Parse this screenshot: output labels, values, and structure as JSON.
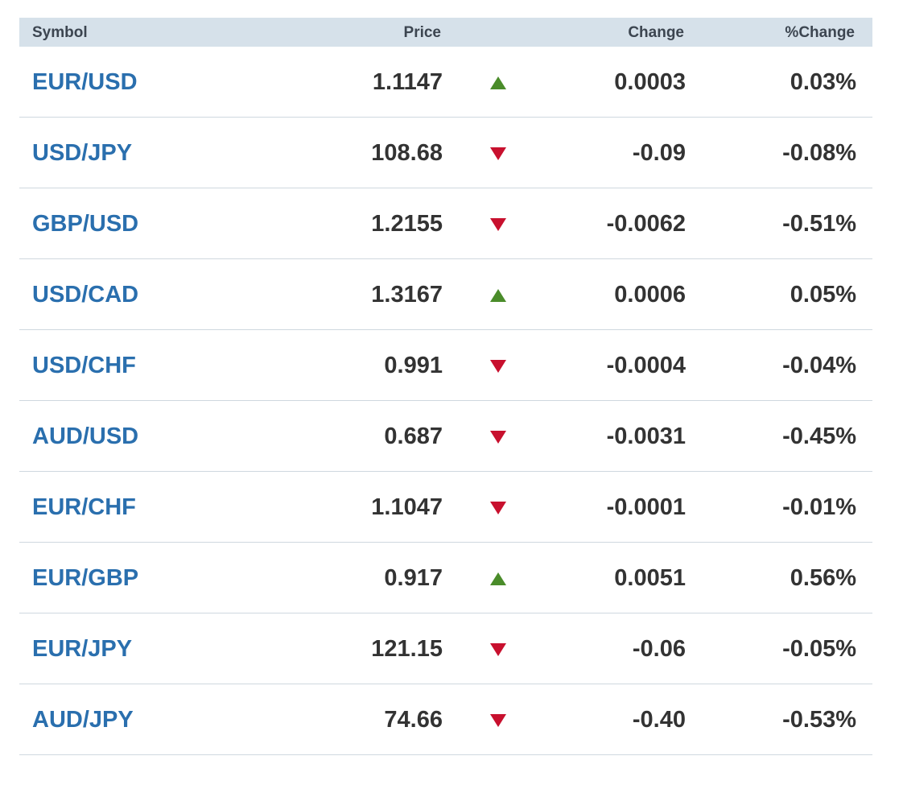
{
  "columns": {
    "symbol": "Symbol",
    "price": "Price",
    "change": "Change",
    "pct_change": "%Change"
  },
  "colors": {
    "header_bg": "#d6e1ea",
    "symbol_link": "#2a6fae",
    "up": "#4a8c2a",
    "down": "#c8102e",
    "text": "#333333",
    "divider": "#cfd8df"
  },
  "rows": [
    {
      "symbol": "EUR/USD",
      "price": "1.1147",
      "direction": "up",
      "change": "0.0003",
      "pct_change": "0.03%"
    },
    {
      "symbol": "USD/JPY",
      "price": "108.68",
      "direction": "down",
      "change": "-0.09",
      "pct_change": "-0.08%"
    },
    {
      "symbol": "GBP/USD",
      "price": "1.2155",
      "direction": "down",
      "change": "-0.0062",
      "pct_change": "-0.51%"
    },
    {
      "symbol": "USD/CAD",
      "price": "1.3167",
      "direction": "up",
      "change": "0.0006",
      "pct_change": "0.05%"
    },
    {
      "symbol": "USD/CHF",
      "price": "0.991",
      "direction": "down",
      "change": "-0.0004",
      "pct_change": "-0.04%"
    },
    {
      "symbol": "AUD/USD",
      "price": "0.687",
      "direction": "down",
      "change": "-0.0031",
      "pct_change": "-0.45%"
    },
    {
      "symbol": "EUR/CHF",
      "price": "1.1047",
      "direction": "down",
      "change": "-0.0001",
      "pct_change": "-0.01%"
    },
    {
      "symbol": "EUR/GBP",
      "price": "0.917",
      "direction": "up",
      "change": "0.0051",
      "pct_change": "0.56%"
    },
    {
      "symbol": "EUR/JPY",
      "price": "121.15",
      "direction": "down",
      "change": "-0.06",
      "pct_change": "-0.05%"
    },
    {
      "symbol": "AUD/JPY",
      "price": "74.66",
      "direction": "down",
      "change": "-0.40",
      "pct_change": "-0.53%"
    }
  ]
}
